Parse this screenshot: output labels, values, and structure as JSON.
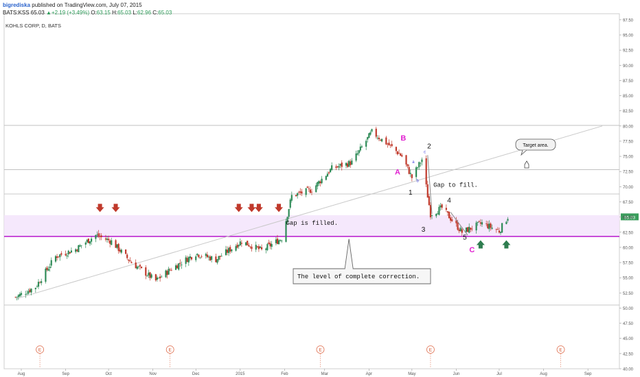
{
  "header": {
    "author": "bigrediska",
    "published": " published on TradingView.com, July 07, 2015",
    "symbol": "BATS:KSS",
    "last": "65.03",
    "change": "+2.19 (+3.49%)",
    "open_label": "O:",
    "open": "63.15",
    "high_label": "H:",
    "high": "65.03",
    "low_label": "L:",
    "low": "62.96",
    "close_label": "C:",
    "close": "65.03"
  },
  "chart_title": "KOHLS CORP, D, BATS",
  "colors": {
    "up": "#2e8b57",
    "down": "#c0392b",
    "gap_zone": "#f3e4fb",
    "level_line": "#b000c8",
    "arrow_down": "#c0392b",
    "arrow_up": "#2e7d4f",
    "wave_magenta": "#e020d0",
    "price_tag": "#3a9d5c"
  },
  "annotations": {
    "gap_filled": "Gap is filled.",
    "gap_to_fill": "Gap to fill.",
    "target_area": "Target area.",
    "level_complete": "The level of complete correction.",
    "wave_A": "A",
    "wave_B": "B",
    "wave_C": "C",
    "wave_1": "1",
    "wave_2": "2",
    "wave_3": "3",
    "wave_4": "4",
    "wave_5": "5",
    "wave_a": "a",
    "wave_b": "b",
    "wave_c": "c",
    "earnings": "E"
  },
  "price_tag": "65.03",
  "chart_data": {
    "type": "candlestick",
    "title": "KOHLS CORP, D, BATS",
    "ylim": [
      40,
      98.5
    ],
    "yticks": [
      "97.50",
      "95.00",
      "92.50",
      "90.00",
      "87.50",
      "85.00",
      "82.50",
      "80.00",
      "77.50",
      "75.00",
      "72.50",
      "70.00",
      "67.50",
      "65.00",
      "62.50",
      "60.00",
      "57.50",
      "55.00",
      "52.50",
      "50.00",
      "47.50",
      "45.00",
      "42.50",
      "40.00"
    ],
    "xticks": [
      "Aug",
      "Sep",
      "Oct",
      "Nov",
      "Dec",
      "2015",
      "Feb",
      "Mar",
      "Apr",
      "May",
      "Jun",
      "Jul",
      "Aug",
      "Sep"
    ],
    "horizontal_levels": [
      80.1,
      72.8,
      68.8,
      61.8,
      50.5
    ],
    "gap_zone": [
      61.8,
      65.3
    ],
    "complete_correction_level": 61.8,
    "last_price": 65.03,
    "price_path": [
      {
        "x": "2014-07-28",
        "y": 51.8
      },
      {
        "x": "2014-08-11",
        "y": 53.5
      },
      {
        "x": "2014-08-25",
        "y": 58.5
      },
      {
        "x": "2014-09-08",
        "y": 59.7
      },
      {
        "x": "2014-09-22",
        "y": 62.0
      },
      {
        "x": "2014-10-03",
        "y": 61.0
      },
      {
        "x": "2014-10-17",
        "y": 57.5
      },
      {
        "x": "2014-11-03",
        "y": 54.5
      },
      {
        "x": "2014-11-14",
        "y": 56.5
      },
      {
        "x": "2014-12-01",
        "y": 59.0
      },
      {
        "x": "2014-12-15",
        "y": 58.0
      },
      {
        "x": "2015-01-02",
        "y": 61.0
      },
      {
        "x": "2015-01-16",
        "y": 59.5
      },
      {
        "x": "2015-01-30",
        "y": 61.5
      },
      {
        "x": "2015-02-06",
        "y": 68.5
      },
      {
        "x": "2015-02-20",
        "y": 69.5
      },
      {
        "x": "2015-03-06",
        "y": 73.0
      },
      {
        "x": "2015-03-20",
        "y": 74.0
      },
      {
        "x": "2015-04-03",
        "y": 79.0
      },
      {
        "x": "2015-04-17",
        "y": 76.5
      },
      {
        "x": "2015-04-24",
        "y": 75.0
      },
      {
        "x": "2015-05-01",
        "y": 71.5
      },
      {
        "x": "2015-05-08",
        "y": 74.5
      },
      {
        "x": "2015-05-14",
        "y": 65.5
      },
      {
        "x": "2015-05-22",
        "y": 66.5
      },
      {
        "x": "2015-06-05",
        "y": 62.5
      },
      {
        "x": "2015-06-19",
        "y": 64.0
      },
      {
        "x": "2015-07-01",
        "y": 62.7
      },
      {
        "x": "2015-07-07",
        "y": 65.03
      }
    ],
    "trendline": [
      {
        "x": "2014-07-28",
        "y": 51.5
      },
      {
        "x": "2015-09-11",
        "y": 80.0
      }
    ],
    "earnings_dates": [
      "2014-08-14",
      "2014-11-13",
      "2015-02-26",
      "2015-05-14",
      "2015-08-13"
    ],
    "down_arrows": [
      "2014-09-25",
      "2014-10-06",
      "2014-12-31",
      "2015-01-09",
      "2015-01-14",
      "2015-01-28"
    ],
    "up_arrows": [
      "2015-06-18",
      "2015-07-06"
    ]
  }
}
